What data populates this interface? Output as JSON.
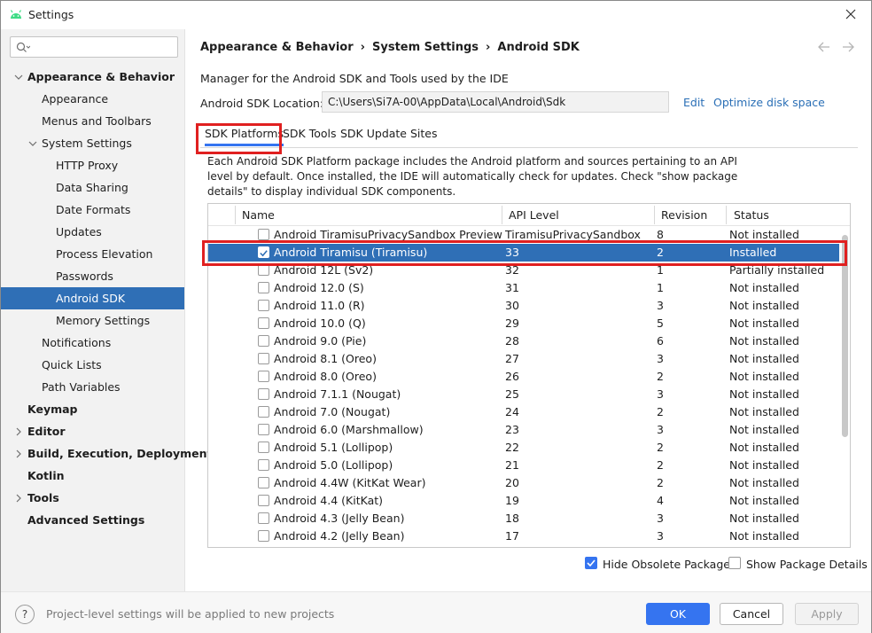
{
  "window": {
    "title": "Settings",
    "close_icon": "close-icon"
  },
  "sidebar": {
    "search_placeholder": "",
    "items": [
      {
        "label": "Appearance & Behavior",
        "bold": true,
        "expanded": true
      },
      {
        "label": "Appearance"
      },
      {
        "label": "Menus and Toolbars"
      },
      {
        "label": "System Settings",
        "expanded": true
      },
      {
        "label": "HTTP Proxy"
      },
      {
        "label": "Data Sharing"
      },
      {
        "label": "Date Formats"
      },
      {
        "label": "Updates"
      },
      {
        "label": "Process Elevation"
      },
      {
        "label": "Passwords"
      },
      {
        "label": "Android SDK",
        "selected": true
      },
      {
        "label": "Memory Settings"
      },
      {
        "label": "Notifications"
      },
      {
        "label": "Quick Lists"
      },
      {
        "label": "Path Variables"
      },
      {
        "label": "Keymap",
        "bold": true
      },
      {
        "label": "Editor",
        "bold": true,
        "expanded": false
      },
      {
        "label": "Build, Execution, Deployment",
        "bold": true,
        "expanded": false
      },
      {
        "label": "Kotlin",
        "bold": true
      },
      {
        "label": "Tools",
        "bold": true,
        "expanded": false
      },
      {
        "label": "Advanced Settings",
        "bold": true
      }
    ]
  },
  "breadcrumb": [
    "Appearance & Behavior",
    "System Settings",
    "Android SDK"
  ],
  "description": "Manager for the Android SDK and Tools used by the IDE",
  "sdk_location": {
    "label": "Android SDK Location:",
    "value": "C:\\Users\\Si7A-00\\AppData\\Local\\Android\\Sdk",
    "edit_link": "Edit",
    "optimize_link": "Optimize disk space"
  },
  "tabs": [
    {
      "label": "SDK Platforms",
      "active": true
    },
    {
      "label": "SDK Tools"
    },
    {
      "label": "SDK Update Sites"
    }
  ],
  "platform_description": "Each Android SDK Platform package includes the Android platform and sources pertaining to an API level by default. Once installed, the IDE will automatically check for updates. Check \"show package details\" to display individual SDK components.",
  "table": {
    "columns": [
      "Name",
      "API Level",
      "Revision",
      "Status"
    ],
    "rows": [
      {
        "name": "Android TiramisuPrivacySandbox Preview",
        "api": "TiramisuPrivacySandbox",
        "rev": "8",
        "status": "Not installed",
        "checked": false
      },
      {
        "name": "Android Tiramisu (Tiramisu)",
        "api": "33",
        "rev": "2",
        "status": "Installed",
        "checked": true,
        "selected": true
      },
      {
        "name": "Android 12L (Sv2)",
        "api": "32",
        "rev": "1",
        "status": "Partially installed",
        "checked": false
      },
      {
        "name": "Android 12.0 (S)",
        "api": "31",
        "rev": "1",
        "status": "Not installed",
        "checked": false
      },
      {
        "name": "Android 11.0 (R)",
        "api": "30",
        "rev": "3",
        "status": "Not installed",
        "checked": false
      },
      {
        "name": "Android 10.0 (Q)",
        "api": "29",
        "rev": "5",
        "status": "Not installed",
        "checked": false
      },
      {
        "name": "Android 9.0 (Pie)",
        "api": "28",
        "rev": "6",
        "status": "Not installed",
        "checked": false
      },
      {
        "name": "Android 8.1 (Oreo)",
        "api": "27",
        "rev": "3",
        "status": "Not installed",
        "checked": false
      },
      {
        "name": "Android 8.0 (Oreo)",
        "api": "26",
        "rev": "2",
        "status": "Not installed",
        "checked": false
      },
      {
        "name": "Android 7.1.1 (Nougat)",
        "api": "25",
        "rev": "3",
        "status": "Not installed",
        "checked": false
      },
      {
        "name": "Android 7.0 (Nougat)",
        "api": "24",
        "rev": "2",
        "status": "Not installed",
        "checked": false
      },
      {
        "name": "Android 6.0 (Marshmallow)",
        "api": "23",
        "rev": "3",
        "status": "Not installed",
        "checked": false
      },
      {
        "name": "Android 5.1 (Lollipop)",
        "api": "22",
        "rev": "2",
        "status": "Not installed",
        "checked": false
      },
      {
        "name": "Android 5.0 (Lollipop)",
        "api": "21",
        "rev": "2",
        "status": "Not installed",
        "checked": false
      },
      {
        "name": "Android 4.4W (KitKat Wear)",
        "api": "20",
        "rev": "2",
        "status": "Not installed",
        "checked": false
      },
      {
        "name": "Android 4.4 (KitKat)",
        "api": "19",
        "rev": "4",
        "status": "Not installed",
        "checked": false
      },
      {
        "name": "Android 4.3 (Jelly Bean)",
        "api": "18",
        "rev": "3",
        "status": "Not installed",
        "checked": false
      },
      {
        "name": "Android 4.2 (Jelly Bean)",
        "api": "17",
        "rev": "3",
        "status": "Not installed",
        "checked": false
      }
    ]
  },
  "options": {
    "hide_obsolete": {
      "label": "Hide Obsolete Packages",
      "checked": true
    },
    "show_details": {
      "label": "Show Package Details",
      "checked": false
    }
  },
  "footer": {
    "help_label": "?",
    "note": "Project-level settings will be applied to new projects",
    "ok": "OK",
    "cancel": "Cancel",
    "apply": "Apply"
  },
  "colors": {
    "accent": "#3574f0",
    "selection": "#2f6fb6",
    "link": "#2a6fb6",
    "highlight_box": "#e02020",
    "android_green": "#3ddc84"
  }
}
